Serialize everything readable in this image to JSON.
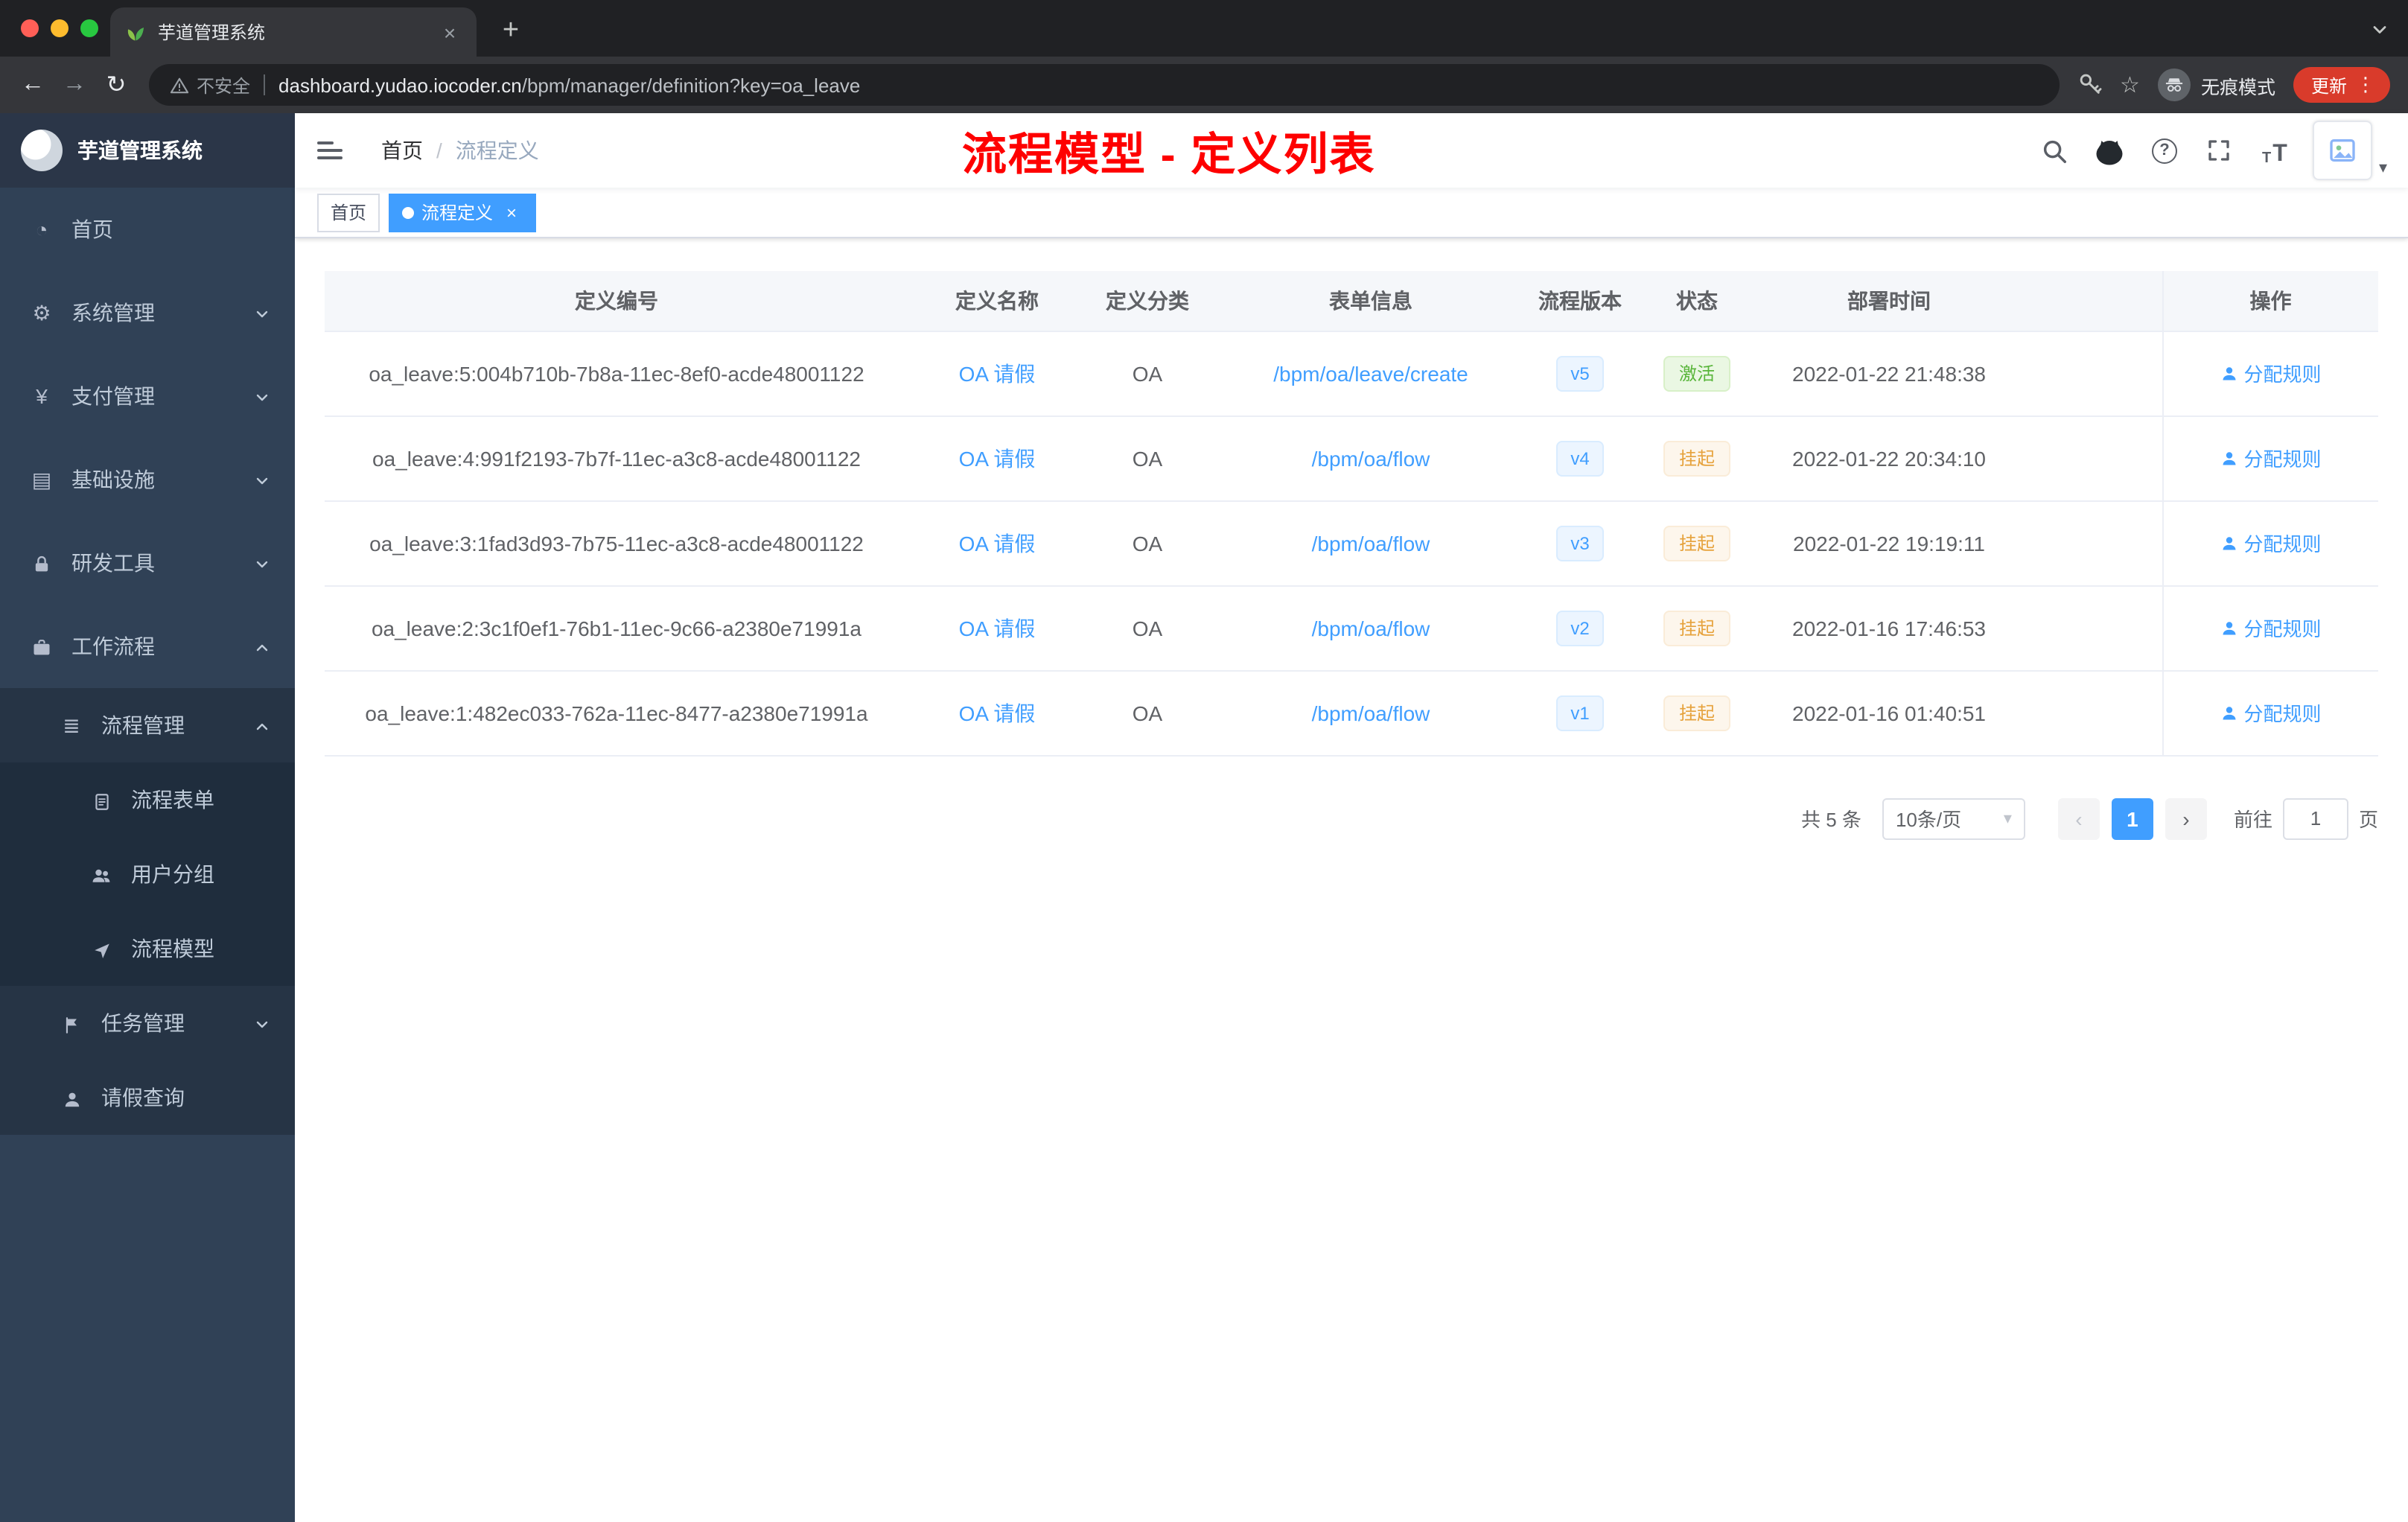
{
  "colors": {
    "accent_blue": "#409eff",
    "success_green": "#67c23a",
    "warning_orange": "#e6a23c",
    "title_red": "#fe0000",
    "sidebar_bg": "#304156"
  },
  "glyphs": {
    "back": "←",
    "forward": "→",
    "reload": "↻",
    "more": "⋮",
    "star": "☆",
    "close": "×",
    "plus": "+",
    "question": "?",
    "font_t": "T",
    "angle_left": "‹",
    "angle_right": "›",
    "caret": "▾",
    "slash": "/",
    "dashboard": "◔",
    "gear": "⚙",
    "yen": "¥",
    "monitor": "▤",
    "list": "≣"
  },
  "browser": {
    "tab_title": "芋道管理系统",
    "security_label": "不安全",
    "url_domain": "dashboard.yudao.iocoder.cn",
    "url_path": "/bpm/manager/definition?key=oa_leave",
    "incognito_label": "无痕模式",
    "update_label": "更新"
  },
  "sidebar": {
    "logo_title": "芋道管理系统",
    "items": [
      {
        "label": "首页"
      },
      {
        "label": "系统管理"
      },
      {
        "label": "支付管理"
      },
      {
        "label": "基础设施"
      },
      {
        "label": "研发工具"
      },
      {
        "label": "工作流程"
      },
      {
        "label": "流程管理"
      },
      {
        "label": "流程表单"
      },
      {
        "label": "用户分组"
      },
      {
        "label": "流程模型"
      },
      {
        "label": "任务管理"
      },
      {
        "label": "请假查询"
      }
    ]
  },
  "header": {
    "breadcrumb": [
      "首页",
      "流程定义"
    ],
    "overlay_title": "流程模型 - 定义列表"
  },
  "tags": [
    {
      "label": "首页"
    },
    {
      "label": "流程定义"
    }
  ],
  "table": {
    "columns": [
      "定义编号",
      "定义名称",
      "定义分类",
      "表单信息",
      "流程版本",
      "状态",
      "部署时间",
      "操作"
    ],
    "rows": [
      {
        "id": "oa_leave:5:004b710b-7b8a-11ec-8ef0-acde48001122",
        "name": "OA 请假",
        "category": "OA",
        "form": "/bpm/oa/leave/create",
        "version": "v5",
        "status": "激活",
        "status_type": "success",
        "deployed_at": "2022-01-22 21:48:38",
        "action": "分配规则"
      },
      {
        "id": "oa_leave:4:991f2193-7b7f-11ec-a3c8-acde48001122",
        "name": "OA 请假",
        "category": "OA",
        "form": "/bpm/oa/flow",
        "version": "v4",
        "status": "挂起",
        "status_type": "warning",
        "deployed_at": "2022-01-22 20:34:10",
        "action": "分配规则"
      },
      {
        "id": "oa_leave:3:1fad3d93-7b75-11ec-a3c8-acde48001122",
        "name": "OA 请假",
        "category": "OA",
        "form": "/bpm/oa/flow",
        "version": "v3",
        "status": "挂起",
        "status_type": "warning",
        "deployed_at": "2022-01-22 19:19:11",
        "action": "分配规则"
      },
      {
        "id": "oa_leave:2:3c1f0ef1-76b1-11ec-9c66-a2380e71991a",
        "name": "OA 请假",
        "category": "OA",
        "form": "/bpm/oa/flow",
        "version": "v2",
        "status": "挂起",
        "status_type": "warning",
        "deployed_at": "2022-01-16 17:46:53",
        "action": "分配规则"
      },
      {
        "id": "oa_leave:1:482ec033-762a-11ec-8477-a2380e71991a",
        "name": "OA 请假",
        "category": "OA",
        "form": "/bpm/oa/flow",
        "version": "v1",
        "status": "挂起",
        "status_type": "warning",
        "deployed_at": "2022-01-16 01:40:51",
        "action": "分配规则"
      }
    ]
  },
  "pagination": {
    "total_label": "共 5 条",
    "page_size_label": "10条/页",
    "current_page": "1",
    "goto_label": "前往",
    "goto_value": "1",
    "page_unit": "页"
  }
}
